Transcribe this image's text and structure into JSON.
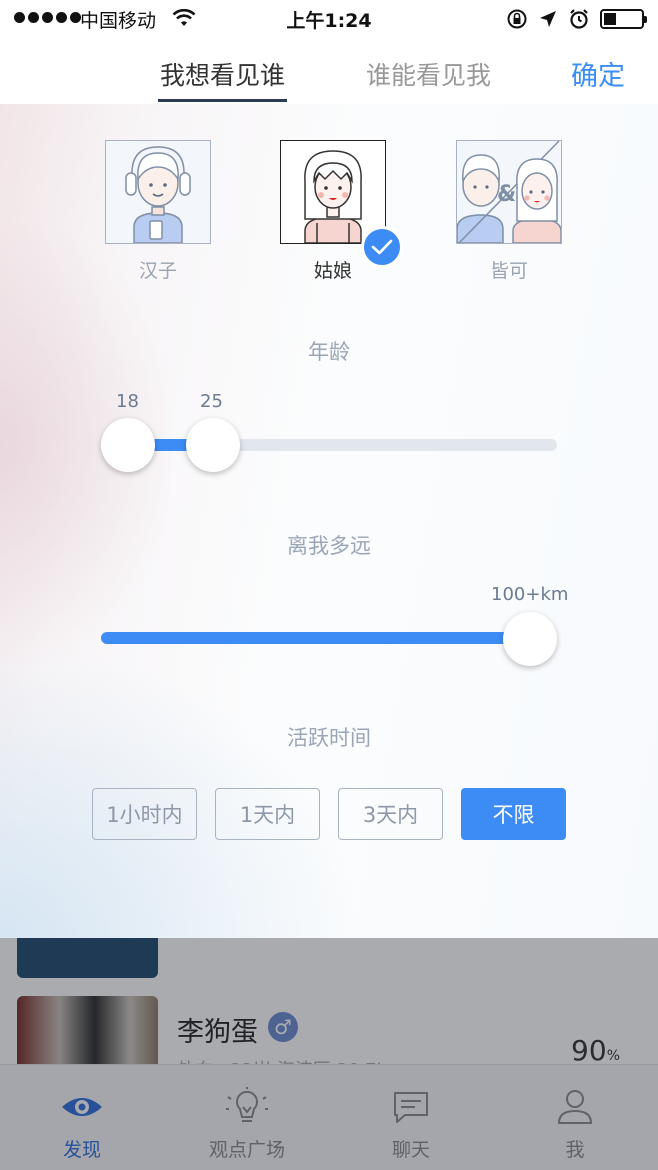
{
  "status_bar": {
    "carrier": "中国移动",
    "time": "上午1:24"
  },
  "header": {
    "tab_active": "我想看见谁",
    "tab_inactive": "谁能看见我",
    "confirm": "确定"
  },
  "gender": {
    "options": [
      {
        "label": "汉子",
        "selected": false
      },
      {
        "label": "姑娘",
        "selected": true
      },
      {
        "label": "皆可",
        "selected": false
      }
    ]
  },
  "age": {
    "title": "年龄",
    "min": "18",
    "max": "25"
  },
  "distance": {
    "title": "离我多远",
    "value": "100+km"
  },
  "active_time": {
    "title": "活跃时间",
    "options": [
      "1小时内",
      "1天内",
      "3天内",
      "不限"
    ],
    "selected": "不限"
  },
  "list": {
    "user_name": "李狗蛋",
    "sex_symbol": "♂",
    "subtitle": "外向 · 23岁 海淀区 20.7k",
    "match": "90",
    "match_unit": "%"
  },
  "tabbar": {
    "items": [
      "发现",
      "观点广场",
      "聊天",
      "我"
    ],
    "active": "发现"
  },
  "colors": {
    "accent": "#3d8cf5",
    "confirm": "#3a8ef6"
  }
}
